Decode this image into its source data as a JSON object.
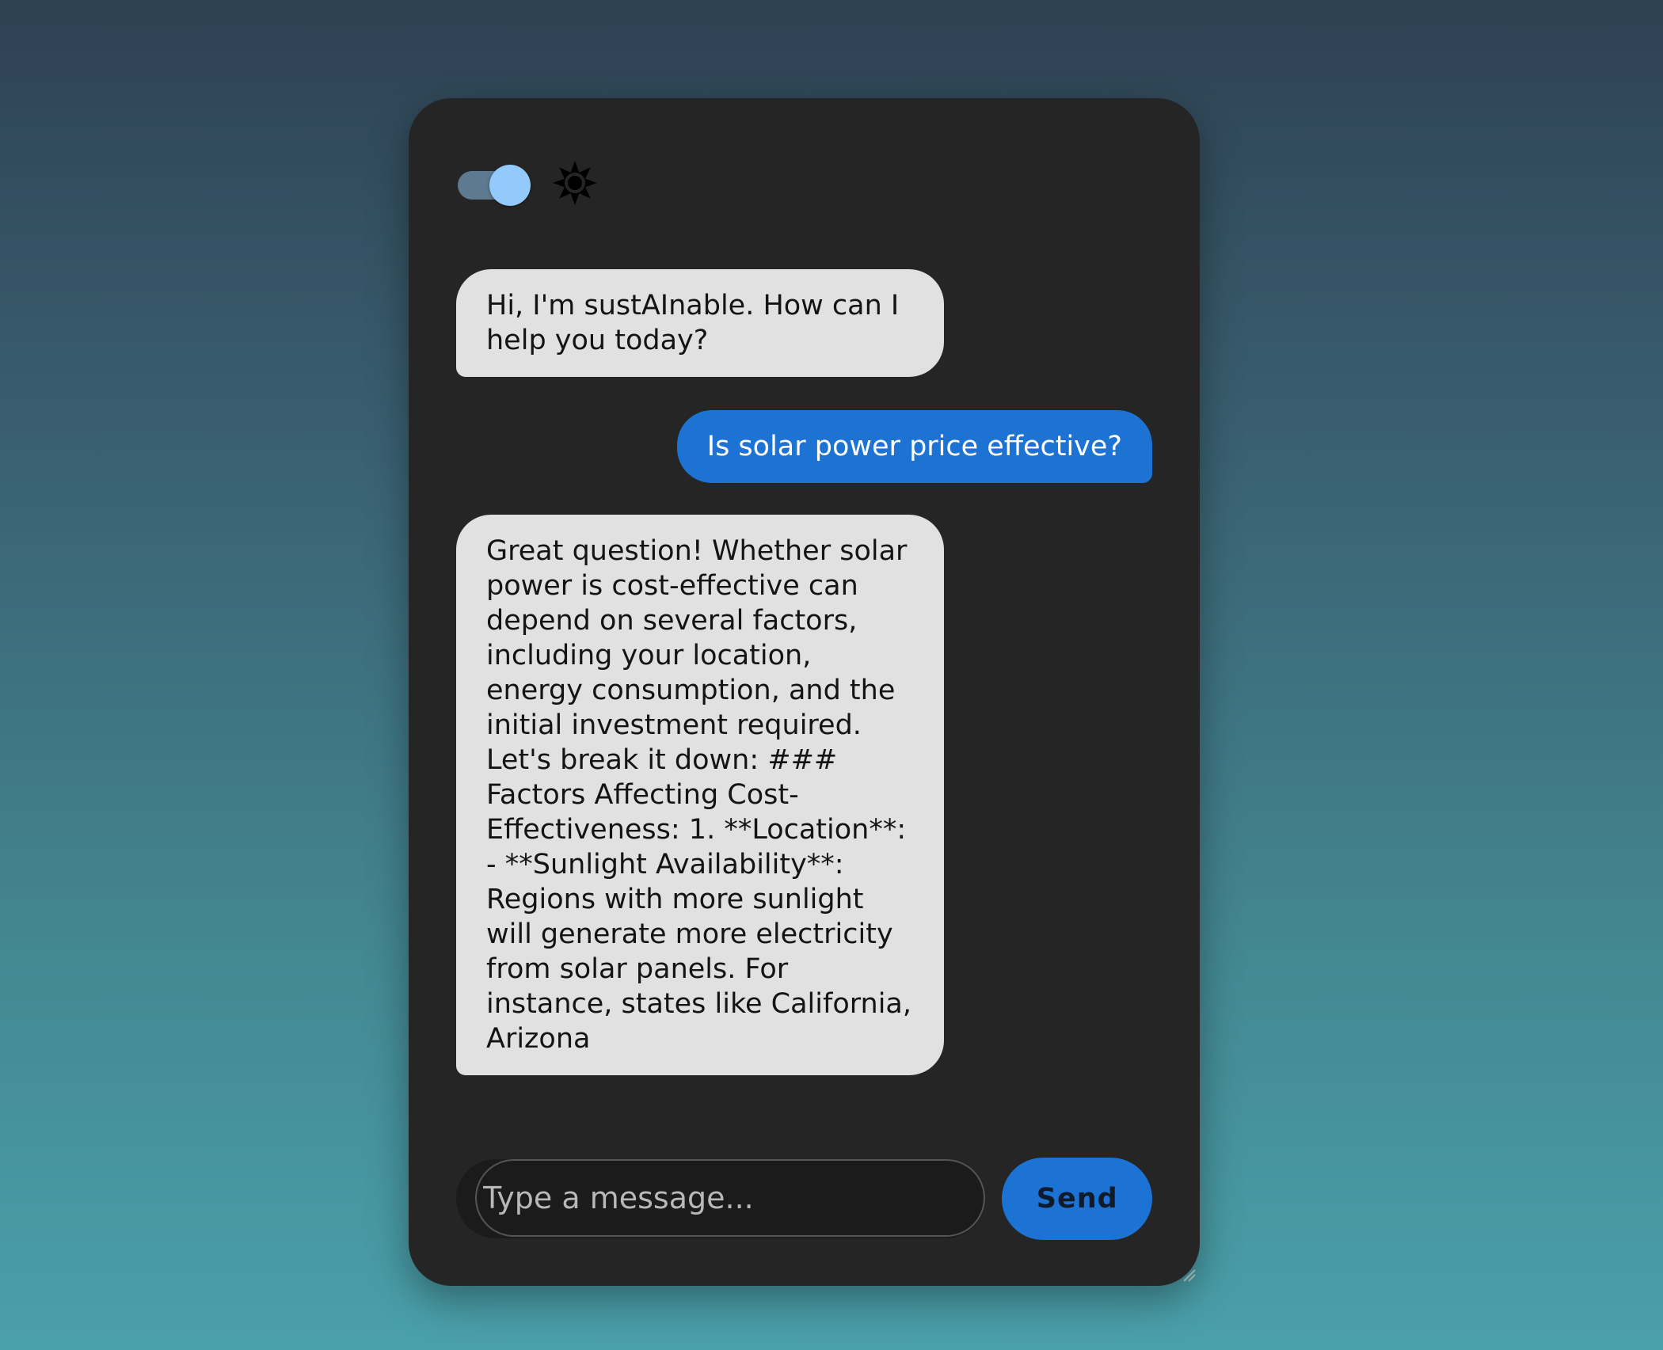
{
  "theme": {
    "toggle_on": true,
    "icon": "sun-icon"
  },
  "messages": [
    {
      "role": "bot",
      "text": "Hi, I'm sustAInable. How can I help you today?"
    },
    {
      "role": "user",
      "text": "Is solar power price effective?"
    },
    {
      "role": "bot",
      "text": "Great question! Whether solar power is cost-effective can depend on several factors, including your location, energy consumption, and the initial investment required. Let's break it down: ### Factors Affecting Cost-Effectiveness: 1. **Location**: - **Sunlight Availability**: Regions with more sunlight will generate more electricity from solar panels. For instance, states like California, Arizona"
    }
  ],
  "composer": {
    "placeholder": "Type a message...",
    "value": "",
    "send_label": "Send"
  },
  "colors": {
    "card_background": "#252525",
    "bot_bubble": "#e1e1e1",
    "user_bubble": "#1d73d4",
    "send_button": "#1d73d4",
    "toggle_knob": "#94c9fb"
  }
}
